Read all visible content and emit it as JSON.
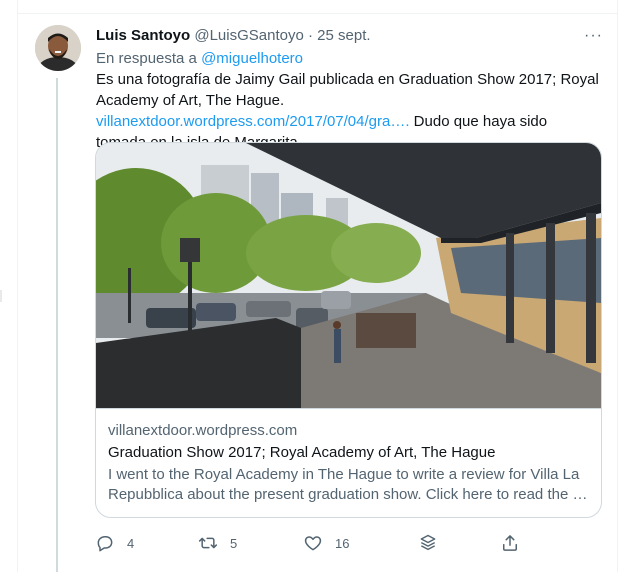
{
  "tweet": {
    "author_name": "Luis Santoyo",
    "author_handle": "@LuisGSantoyo",
    "separator": "·",
    "date": "25 sept.",
    "more_label": "···",
    "reply_prefix": "En respuesta a",
    "reply_mention": "@miguelhotero",
    "text_before_link": "Es una fotografía de Jaimy Gail publicada en Graduation Show 2017; Royal Academy of Art, The Hague. ",
    "link_text": "villanextdoor.wordpress.com/2017/07/04/gra….",
    "text_after_link": " Dudo que haya sido tomada en la isla de Margarita"
  },
  "card": {
    "domain": "villanextdoor.wordpress.com",
    "title": "Graduation Show 2017; Royal Academy of Art, The Hague",
    "description": "I went to the Royal Academy in The Hague to write a review for Villa La Repubblica about the present graduation show. Click here to read the …"
  },
  "actions": {
    "reply_count": "4",
    "retweet_count": "5",
    "like_count": "16"
  },
  "icons": [
    "more-icon",
    "reply-icon",
    "retweet-icon",
    "like-icon",
    "analytics-icon",
    "share-icon"
  ],
  "colors": {
    "link": "#1d9bf0",
    "secondary_text": "#536471",
    "border": "#cfd9de"
  }
}
